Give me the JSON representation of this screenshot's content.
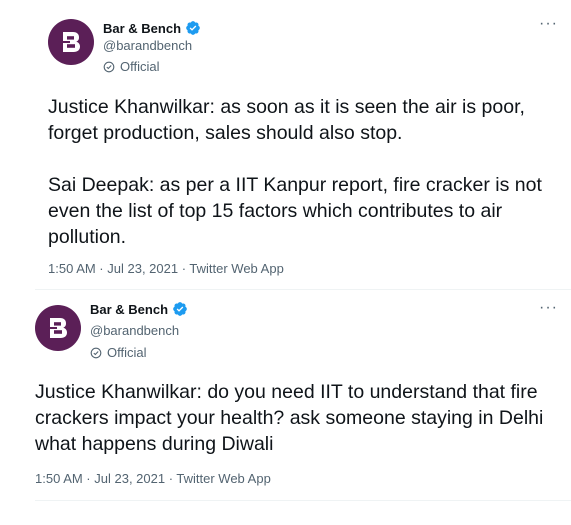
{
  "tweets": [
    {
      "author": {
        "name": "Bar & Bench",
        "handle": "@barandbench",
        "label": "Official",
        "logo_letter": "B"
      },
      "more": "···",
      "paragraphs": [
        "Justice Khanwilkar: as soon as it is seen the air is poor, forget production, sales should also stop.",
        "Sai Deepak: as per a IIT Kanpur report, fire cracker is not even the list of top 15 factors which contributes to air pollution."
      ],
      "meta": "1:50 AM · Jul 23, 2021 · Twitter Web App"
    },
    {
      "author": {
        "name": "Bar & Bench",
        "handle": "@barandbench",
        "label": "Official",
        "logo_letter": "B"
      },
      "more": "···",
      "paragraphs": [
        "Justice Khanwilkar: do you need IIT to understand that fire crackers impact your health? ask someone staying in Delhi what happens during Diwali"
      ],
      "meta": "1:50 AM · Jul 23, 2021 · Twitter Web App"
    }
  ],
  "colors": {
    "avatar_bg": "#5b1f57",
    "verified_blue": "#1d9bf0",
    "text_primary": "#0f1419",
    "text_secondary": "#536471",
    "divider": "#eff3f4"
  }
}
